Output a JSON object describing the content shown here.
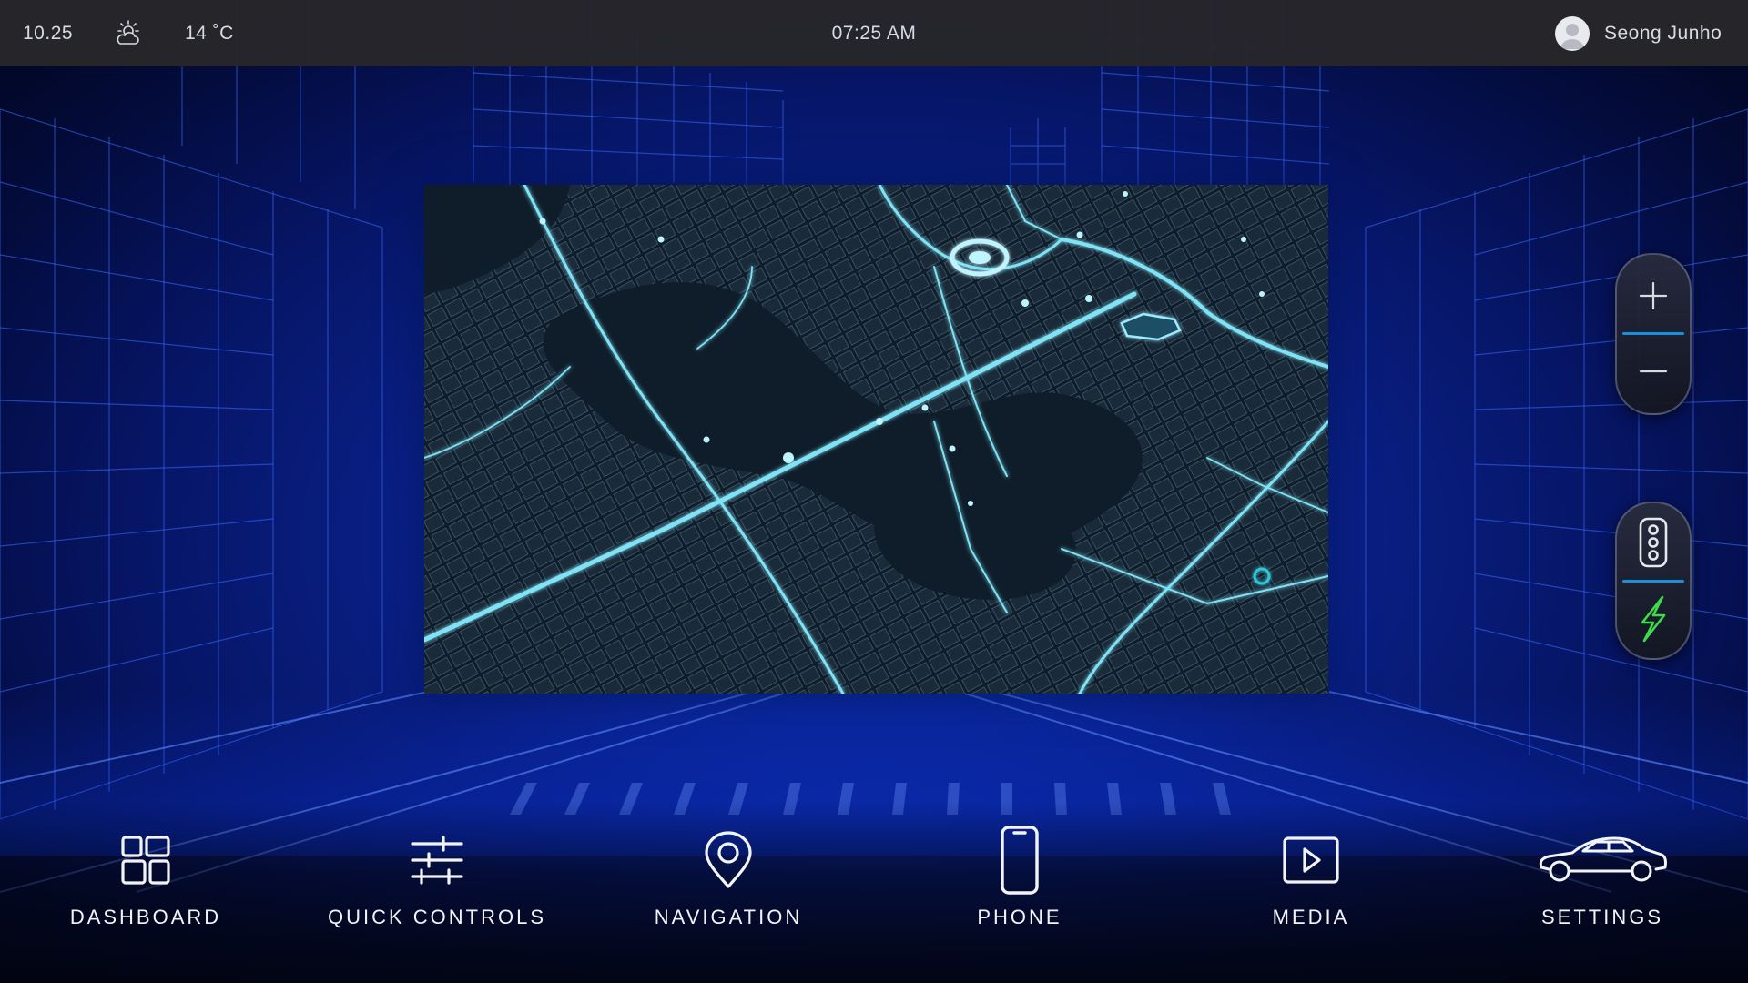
{
  "status_bar": {
    "odometer": "10.25",
    "weather_icon": "partly-sunny-icon",
    "temperature": "14 ˚C",
    "clock": "07:25 AM",
    "user_name": "Seong Junho",
    "avatar_icon": "user-avatar-icon"
  },
  "map": {
    "destination_badge": "",
    "zoom_in_icon": "plus-icon",
    "zoom_out_icon": "minus-icon",
    "traffic_icon": "traffic-light-icon",
    "charging_icon": "lightning-bolt-icon"
  },
  "colors": {
    "accent_blue": "#1a8fdb",
    "charging_green": "#3ddc4a",
    "status_bar_bg": "#26262a",
    "map_road": "#7fe3f5"
  },
  "nav": {
    "items": [
      {
        "label": "DASHBOARD",
        "icon": "dashboard-grid-icon"
      },
      {
        "label": "QUICK CONTROLS",
        "icon": "sliders-icon"
      },
      {
        "label": "NAVIGATION",
        "icon": "location-pin-icon"
      },
      {
        "label": "PHONE",
        "icon": "smartphone-icon"
      },
      {
        "label": "MEDIA",
        "icon": "play-icon"
      },
      {
        "label": "SETTINGS",
        "icon": "car-icon"
      }
    ]
  }
}
